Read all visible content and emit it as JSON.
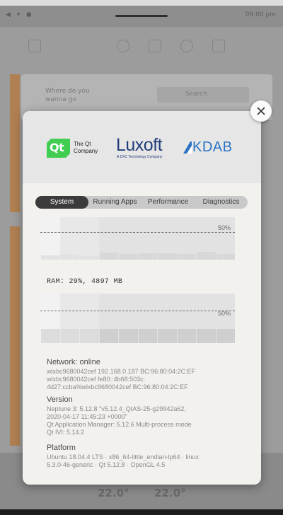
{
  "background": {
    "status_icons": "◀ ▾ ◼",
    "clock": "09:00 pm",
    "card_text": "Where do you wanna go",
    "search_label": "Search",
    "temp_left": "22.0°",
    "temp_right": "22.0°"
  },
  "dialog": {
    "close_icon": "close-icon",
    "logos": {
      "qt": {
        "badge": "Qt",
        "line1": "The Qt",
        "line2": "Company",
        "color": "#41cd52"
      },
      "luxoft": {
        "word": "Luxoft",
        "subtitle": "A DXC Technology Company",
        "color": "#213d79"
      },
      "kdab": {
        "word": "KDAB",
        "color": "#2b74c3"
      }
    },
    "tabs": [
      {
        "label": "System",
        "active": true
      },
      {
        "label": "Running Apps",
        "active": false
      },
      {
        "label": "Performance",
        "active": false
      },
      {
        "label": "Diagnostics",
        "active": false
      }
    ],
    "cpu_chart": {
      "threshold_label": "50%",
      "values": [
        0.1,
        0.12,
        0.08,
        0.17,
        0.13,
        0.15,
        0.15,
        0.13,
        0.19,
        0.13
      ]
    },
    "ram": {
      "label": "RAM: 29%, 4897 MB",
      "chart": {
        "threshold_label": "50%",
        "values": [
          0.29,
          0.29,
          0.29,
          0.29,
          0.29,
          0.29,
          0.29,
          0.29,
          0.29,
          0.29
        ]
      }
    },
    "network": {
      "heading": "Network: online",
      "details": "wlxbc9680042cef 192.168.0.187 BC:96:80:04:2C:EF\nwlxbc9680042cef fe80::4b68:503c:\n4d27:ccba%wlxbc9680042cef BC:96:80:04:2C:EF"
    },
    "version": {
      "heading": "Version",
      "details": "Neptune 3: 5.12.8 \"v5.12.4_QtAS-25-g29942a62,\n2020-04-17 11:45:23 +0000\"\nQt Application Manager: 5.12.6 Multi-process mode\nQt IVI: 5.14.2"
    },
    "platform": {
      "heading": "Platform",
      "details": "Ubuntu 18.04.4 LTS · x86_64-little_endian-lp64 · linux\n5.3.0-46-generic · Qt 5.12.8 · OpenGL 4.5"
    }
  }
}
